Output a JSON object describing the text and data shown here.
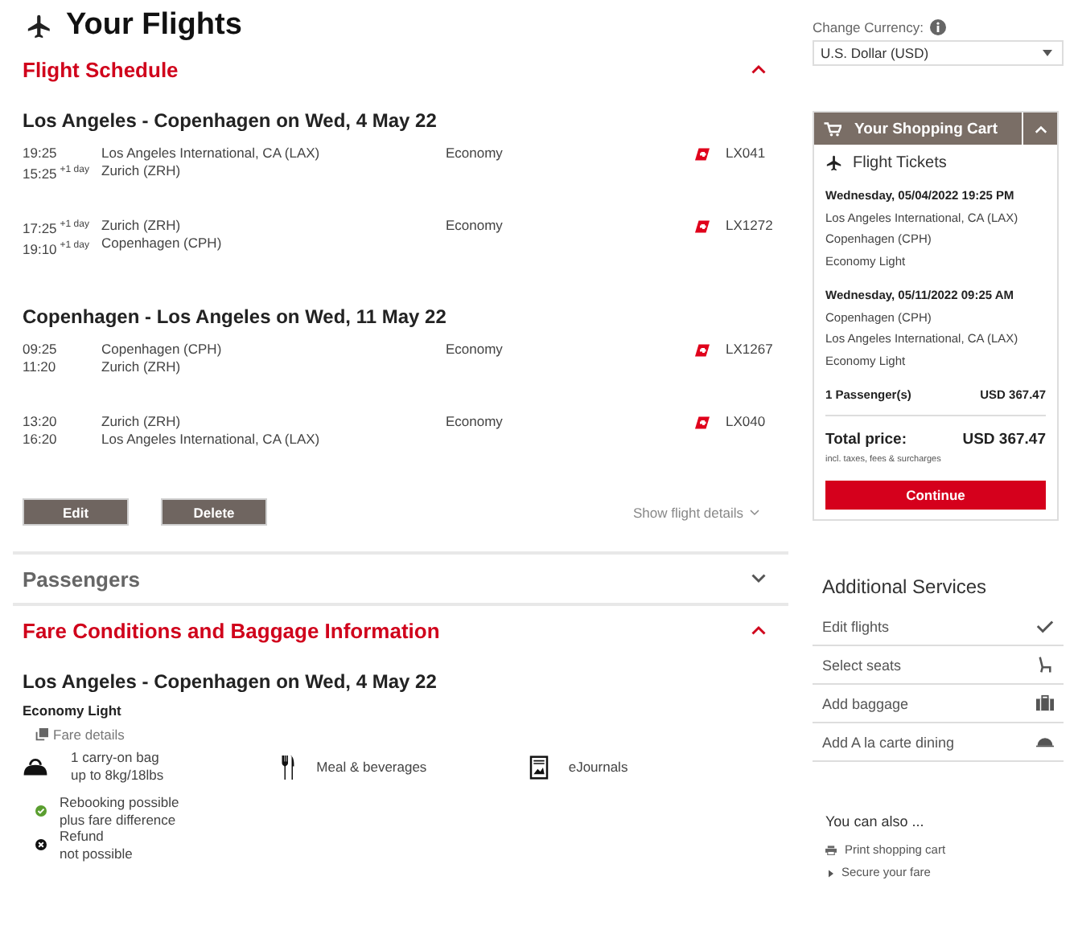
{
  "page_title": "Your Flights",
  "sections": [
    {
      "kind": "schedule",
      "title": "Flight Schedule",
      "expanded": true,
      "journeys": [
        {
          "heading": "Los Angeles - Copenhagen on Wed, 4 May 22",
          "segments": [
            {
              "departure_time": "19:25",
              "arrival_time": "15:25",
              "arrival_day": "+1 day",
              "from": "Los Angeles International, CA (LAX)",
              "to": "Zurich (ZRH)",
              "cabin": "Economy",
              "flight": "LX041"
            },
            {
              "departure_time": "17:25",
              "departure_day": "+1 day",
              "arrival_time": "19:10",
              "arrival_day": "+1 day",
              "from": "Zurich (ZRH)",
              "to": "Copenhagen (CPH)",
              "cabin": "Economy",
              "flight": "LX1272"
            }
          ]
        },
        {
          "heading": "Copenhagen - Los Angeles on Wed, 11 May 22",
          "segments": [
            {
              "departure_time": "09:25",
              "arrival_time": "11:20",
              "from": "Copenhagen (CPH)",
              "to": "Zurich (ZRH)",
              "cabin": "Economy",
              "flight": "LX1267"
            },
            {
              "departure_time": "13:20",
              "arrival_time": "16:20",
              "from": "Zurich (ZRH)",
              "to": "Los Angeles International, CA (LAX)",
              "cabin": "Economy",
              "flight": "LX040"
            }
          ]
        }
      ],
      "buttons": [
        "Edit",
        "Delete"
      ],
      "details_link": "Show flight details"
    },
    {
      "kind": "passengers",
      "title": "Passengers",
      "expanded": false
    },
    {
      "kind": "fare",
      "title": "Fare Conditions and Baggage Information",
      "expanded": true,
      "heading": "Los Angeles - Copenhagen on Wed, 4 May 22",
      "fare_name": "Economy Light",
      "fare_details_link": "Fare details",
      "amenities": [
        {
          "kind": "bag",
          "lines": [
            "1 carry-on bag",
            "up to 8kg/18lbs"
          ]
        },
        {
          "kind": "meal",
          "lines": [
            "Meal & beverages"
          ]
        },
        {
          "kind": "journal",
          "lines": [
            "eJournals"
          ]
        }
      ],
      "conditions": [
        {
          "allowed": true,
          "lines": [
            "Rebooking possible",
            "plus fare difference"
          ]
        },
        {
          "allowed": false,
          "lines": [
            "Refund",
            "not possible"
          ]
        }
      ]
    }
  ],
  "sidebar": {
    "currency": {
      "label": "Change Currency:",
      "value": "U.S. Dollar (USD)"
    },
    "cart": {
      "title": "Your Shopping Cart",
      "expanded": true,
      "section_title": "Flight Tickets",
      "trips": [
        {
          "date": "Wednesday, 05/04/2022 19:25 PM",
          "lines": [
            "Los Angeles International, CA (LAX)",
            "Copenhagen (CPH)",
            "Economy Light"
          ]
        },
        {
          "date": "Wednesday, 05/11/2022 09:25 AM",
          "lines": [
            "Copenhagen (CPH)",
            "Los Angeles International, CA (LAX)",
            "Economy Light"
          ]
        }
      ],
      "passengers_label": "1 Passenger(s)",
      "passengers_price": "USD 367.47",
      "total_label": "Total price:",
      "total_price": "USD 367.47",
      "total_note": "incl. taxes, fees & surcharges",
      "button": "Continue"
    },
    "services": {
      "title": "Additional Services",
      "items": [
        {
          "label": "Edit flights",
          "kind": "check"
        },
        {
          "label": "Select seats",
          "kind": "seat"
        },
        {
          "label": "Add baggage",
          "kind": "suitcase"
        },
        {
          "label": "Add A la carte dining",
          "kind": "dining"
        }
      ]
    },
    "also": {
      "title": "You can also ...",
      "links": [
        {
          "label": "Print shopping cart",
          "kind": "print"
        },
        {
          "label": "Secure your fare",
          "kind": "arrow"
        }
      ]
    }
  }
}
